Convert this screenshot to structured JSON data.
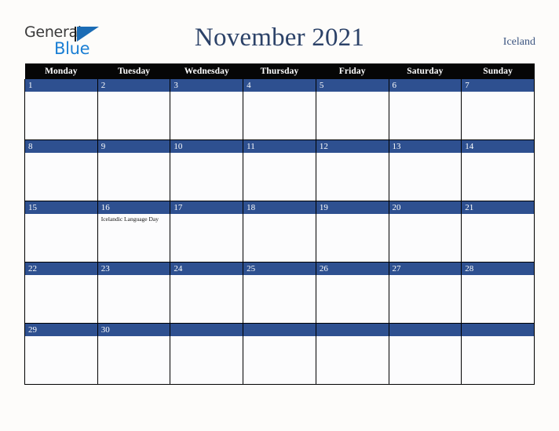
{
  "brand": {
    "line1": "General",
    "line2": "Blue",
    "triangle_icon": "blue-triangle-icon",
    "accent_color": "#1b7fd4"
  },
  "header": {
    "title": "November 2021",
    "country": "Iceland",
    "title_color": "#2c4268"
  },
  "colors": {
    "page_background": "#fdfcfa",
    "weekday_header_background": "#060606",
    "weekday_header_text": "#ffffff",
    "day_band_background": "#2e5090",
    "day_band_text": "#ffffff",
    "cell_background": "#fcfcfd",
    "grid_border": "#000000"
  },
  "calendar": {
    "month": "November",
    "year": "2021",
    "weekday_headers": [
      "Monday",
      "Tuesday",
      "Wednesday",
      "Thursday",
      "Friday",
      "Saturday",
      "Sunday"
    ],
    "weeks": [
      [
        {
          "date": "1",
          "events": []
        },
        {
          "date": "2",
          "events": []
        },
        {
          "date": "3",
          "events": []
        },
        {
          "date": "4",
          "events": []
        },
        {
          "date": "5",
          "events": []
        },
        {
          "date": "6",
          "events": []
        },
        {
          "date": "7",
          "events": []
        }
      ],
      [
        {
          "date": "8",
          "events": []
        },
        {
          "date": "9",
          "events": []
        },
        {
          "date": "10",
          "events": []
        },
        {
          "date": "11",
          "events": []
        },
        {
          "date": "12",
          "events": []
        },
        {
          "date": "13",
          "events": []
        },
        {
          "date": "14",
          "events": []
        }
      ],
      [
        {
          "date": "15",
          "events": []
        },
        {
          "date": "16",
          "events": [
            "Icelandic Language Day"
          ]
        },
        {
          "date": "17",
          "events": []
        },
        {
          "date": "18",
          "events": []
        },
        {
          "date": "19",
          "events": []
        },
        {
          "date": "20",
          "events": []
        },
        {
          "date": "21",
          "events": []
        }
      ],
      [
        {
          "date": "22",
          "events": []
        },
        {
          "date": "23",
          "events": []
        },
        {
          "date": "24",
          "events": []
        },
        {
          "date": "25",
          "events": []
        },
        {
          "date": "26",
          "events": []
        },
        {
          "date": "27",
          "events": []
        },
        {
          "date": "28",
          "events": []
        }
      ],
      [
        {
          "date": "29",
          "events": []
        },
        {
          "date": "30",
          "events": []
        },
        {
          "date": "",
          "events": []
        },
        {
          "date": "",
          "events": []
        },
        {
          "date": "",
          "events": []
        },
        {
          "date": "",
          "events": []
        },
        {
          "date": "",
          "events": []
        }
      ]
    ]
  }
}
